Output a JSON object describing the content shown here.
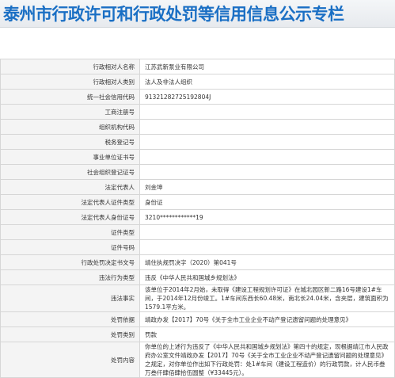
{
  "banner": {
    "title": "泰州市行政许可和行政处罚等信用信息公示专栏"
  },
  "rows": [
    {
      "label": "行政相对人名称",
      "value": "江苏武新泵业有限公司",
      "size": "h19"
    },
    {
      "label": "行政相对人类别",
      "value": "法人及非法人组织",
      "size": "h19"
    },
    {
      "label": "统一社会信用代码",
      "value": "91321282725192804J",
      "size": "h19"
    },
    {
      "label": "工商注册号",
      "value": "",
      "size": "h19"
    },
    {
      "label": "组织机构代码",
      "value": "",
      "size": "h19"
    },
    {
      "label": "税务登记号",
      "value": "",
      "size": "h19"
    },
    {
      "label": "事业单位证书号",
      "value": "",
      "size": "h19"
    },
    {
      "label": "社会组织登记证号",
      "value": "",
      "size": "h19"
    },
    {
      "label": "法定代表人",
      "value": "刘金坤",
      "size": "h19"
    },
    {
      "label": "法定代表人证件类型",
      "value": "身份证",
      "size": "h19"
    },
    {
      "label": "法定代表人身份证号",
      "value": "3210************19",
      "size": "h19"
    },
    {
      "label": "证件类型",
      "value": "",
      "size": "h19"
    },
    {
      "label": "证件号码",
      "value": "",
      "size": "h19"
    },
    {
      "label": "行政处罚决定书文号",
      "value": "靖住执规罚决字（2020）第041号",
      "size": "h19"
    },
    {
      "label": "违法行为类型",
      "value": "违反《中华人民共和国城乡规划法》",
      "size": "h19"
    },
    {
      "label": "违法事实",
      "value": "该单位于2014年2月始，未取得《建设工程规划许可证》在城北园区新二路16号建设1#车间，于2014年12月份竣工。1#车间东西长60.48米，南北长24.04米，含夹层，建筑面积为1579.1平方米。",
      "size": "h23"
    },
    {
      "label": "处罚依据",
      "value": "靖政办发【2017】70号《关于全市工业企业不动产登记遗留问题的处理意见》",
      "size": "h19"
    },
    {
      "label": "处罚类别",
      "value": "罚款",
      "size": "h19"
    },
    {
      "label": "处罚内容",
      "value": "你单位的上述行为违反了《中华人民共和国城乡规划法》第四十的规定，现根据靖江市人民政府办公室文件靖政办发【2017】70号《关于全市工业企业不动产登记遗留问题的处理意见》之规定，对你单位作出如下行政处罚：处1#车间（建设工程造价）的行政罚款，计人民币叁万叁仟肆佰肆拾伍圆整（¥33445元）。",
      "size": "h36"
    }
  ]
}
